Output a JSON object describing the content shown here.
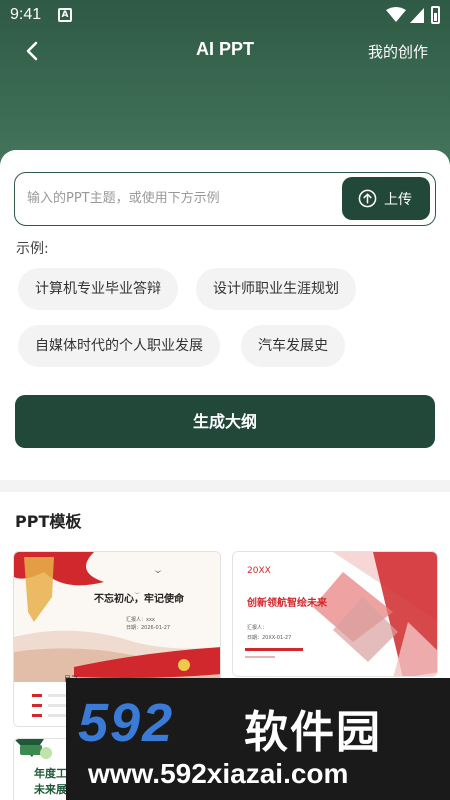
{
  "status_bar": {
    "time": "9:41",
    "notification_glyph": "A"
  },
  "nav": {
    "title": "AI PPT",
    "my_works": "我的创作",
    "back_icon": "chevron-left-icon"
  },
  "input": {
    "placeholder": "输入的PPT主题，或使用下方示例",
    "value": ""
  },
  "upload": {
    "label": "上传",
    "icon": "arrow-up-circle-icon"
  },
  "examples": {
    "label": "示例:",
    "items": [
      "计算机专业毕业答辩",
      "设计师职业生涯规划",
      "自媒体时代的个人职业发展",
      "汽车发展史"
    ]
  },
  "generate_button": "生成大纲",
  "templates": {
    "title": "PPT模板",
    "items": [
      {
        "heading": "不忘初心，牢记使命",
        "reporter": "汇报人：xxx",
        "date": "日期：2026-01-27",
        "footer": "目录"
      },
      {
        "year": "20XX",
        "heading": "创新领航智绘未来",
        "reporter": "汇报人：",
        "date": "日期：20XX-01-27"
      },
      {
        "heading": "年度工作总结",
        "sub": "未来展望"
      }
    ]
  },
  "watermark": {
    "logo": "592",
    "name": "软件园",
    "url": "www.592xiazai.com"
  },
  "colors": {
    "primary": "#22483a",
    "header_top": "#2f5a45",
    "chip_bg": "#f2f3f2",
    "template_red": "#d0282c"
  }
}
